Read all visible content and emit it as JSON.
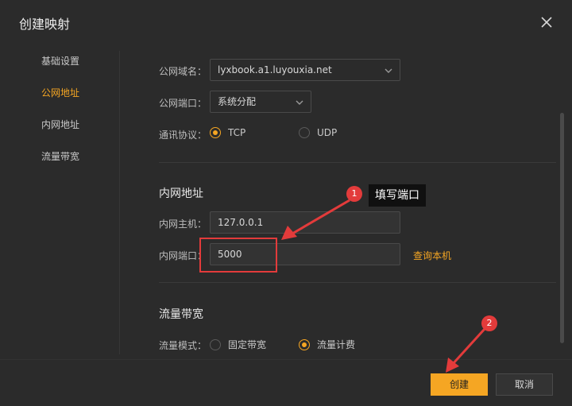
{
  "dialog": {
    "title": "创建映射",
    "close_icon": "close-icon"
  },
  "sidebar": {
    "items": [
      {
        "label": "基础设置",
        "active": false
      },
      {
        "label": "公网地址",
        "active": true
      },
      {
        "label": "内网地址",
        "active": false
      },
      {
        "label": "流量带宽",
        "active": false
      }
    ]
  },
  "public": {
    "domain_label": "公网域名：",
    "domain_value": "lyxbook.a1.luyouxia.net",
    "port_label": "公网端口：",
    "port_value": "系统分配",
    "protocol_label": "通讯协议：",
    "protocol_options": [
      {
        "label": "TCP",
        "checked": true
      },
      {
        "label": "UDP",
        "checked": false
      }
    ]
  },
  "private": {
    "section_title": "内网地址",
    "host_label": "内网主机：",
    "host_value": "127.0.0.1",
    "port_label": "内网端口：",
    "port_value": "5000",
    "query_link": "查询本机"
  },
  "bandwidth": {
    "section_title": "流量带宽",
    "mode_label": "流量模式：",
    "mode_options": [
      {
        "label": "固定带宽",
        "checked": false
      },
      {
        "label": "流量计费",
        "checked": true
      }
    ]
  },
  "footer": {
    "create_label": "创建",
    "cancel_label": "取消"
  },
  "annotations": {
    "badge_1": "1",
    "badge_2": "2",
    "tooltip_text": "填写端口",
    "color": "#e33b3b"
  },
  "colors": {
    "accent": "#f5a623",
    "background": "#2b2b2b"
  }
}
